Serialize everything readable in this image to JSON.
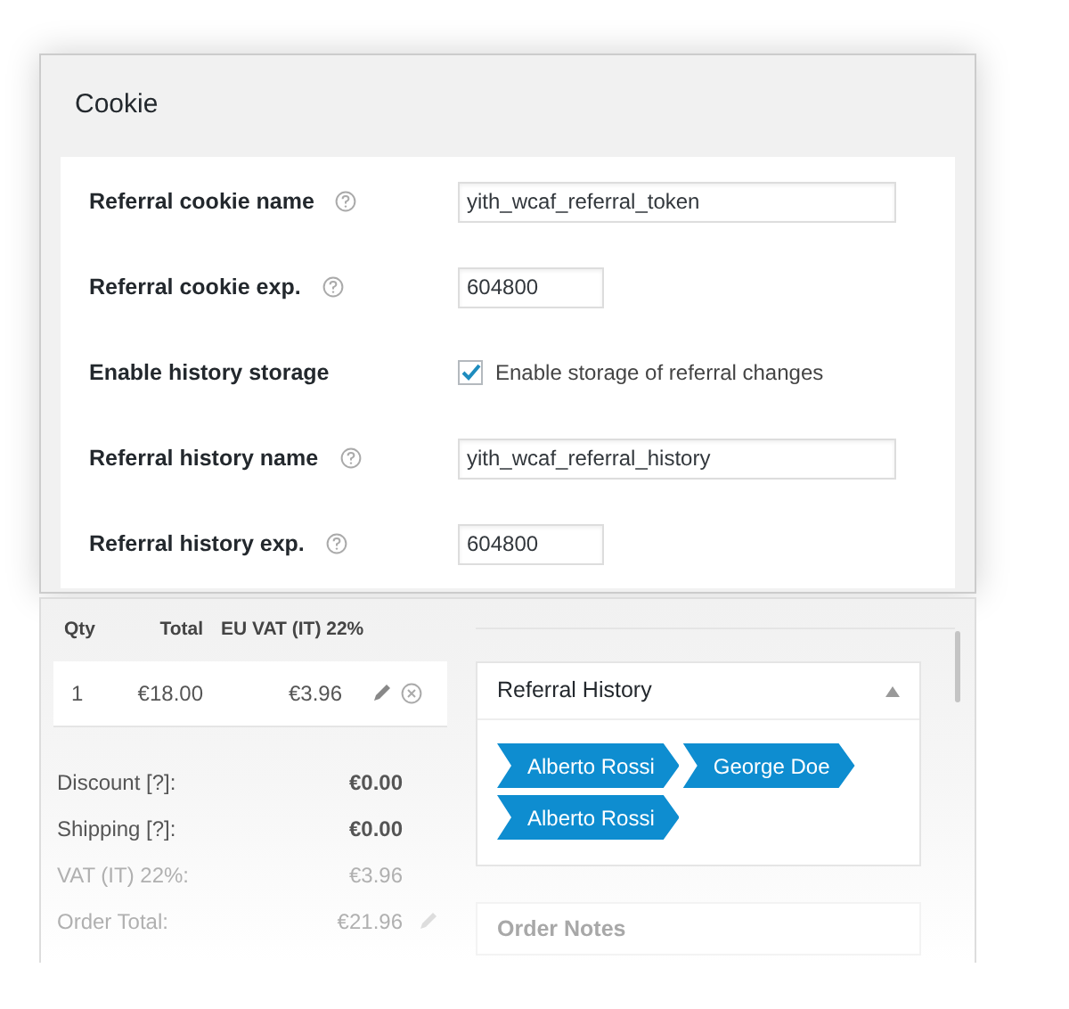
{
  "cookie_panel": {
    "title": "Cookie",
    "fields": [
      {
        "kind": "text",
        "label": "Referral cookie name",
        "help": true,
        "value": "yith_wcaf_referral_token"
      },
      {
        "kind": "number",
        "label": "Referral cookie exp.",
        "help": true,
        "value": "604800"
      },
      {
        "kind": "checkbox",
        "label": "Enable history storage",
        "help": false,
        "checked": true,
        "option": "Enable storage of referral changes"
      },
      {
        "kind": "text",
        "label": "Referral history name",
        "help": true,
        "value": "yith_wcaf_referral_history"
      },
      {
        "kind": "number",
        "label": "Referral history exp.",
        "help": true,
        "value": "604800"
      }
    ]
  },
  "order_items": {
    "columns": [
      "Qty",
      "Total",
      "EU VAT (IT) 22%"
    ],
    "rows": [
      {
        "qty": "1",
        "total": "€18.00",
        "vat": "€3.96"
      }
    ],
    "totals": [
      {
        "label": "Discount [?]:",
        "value": "€0.00",
        "faded": false,
        "editable": false
      },
      {
        "label": "Shipping [?]:",
        "value": "€0.00",
        "faded": false,
        "editable": false
      },
      {
        "label": "VAT (IT) 22%:",
        "value": "€3.96",
        "faded": true,
        "editable": false
      },
      {
        "label": "Order Total:",
        "value": "€21.96",
        "faded": true,
        "editable": true
      }
    ]
  },
  "referral_history": {
    "title": "Referral History",
    "expanded": true,
    "tags": [
      "Alberto Rossi",
      "George Doe",
      "Alberto Rossi"
    ]
  },
  "order_notes": {
    "title": "Order Notes"
  }
}
